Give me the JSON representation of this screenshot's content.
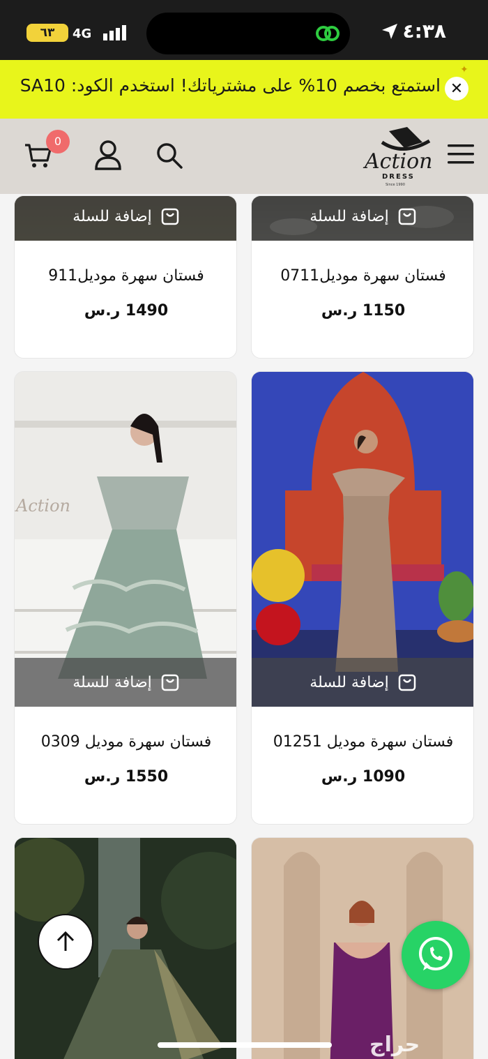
{
  "status_bar": {
    "time": "٤:٣٨",
    "battery": "٦٣",
    "signal_text": "4G"
  },
  "promo": {
    "text": "استمتع بخصم 10% على مشترياتك! استخدم الكود: SA10",
    "close_symbol": "✕"
  },
  "header": {
    "logo_title": "Action",
    "logo_subtitle": "DRESS",
    "logo_since": "Since 1990",
    "cart_count": "0"
  },
  "products": [
    {
      "name": "فستان سهرة موديل0711",
      "price": "1150 ر.س",
      "add_label": "إضافة للسلة"
    },
    {
      "name": "فستان سهرة موديل911",
      "price": "1490 ر.س",
      "add_label": "إضافة للسلة"
    },
    {
      "name": "فستان سهرة موديل 01251",
      "price": "1090 ر.س",
      "add_label": "إضافة للسلة"
    },
    {
      "name": "فستان سهرة موديل 0309",
      "price": "1550 ر.س",
      "add_label": "إضافة للسلة"
    },
    {
      "name": "",
      "price": "",
      "add_label": ""
    },
    {
      "name": "",
      "price": "",
      "add_label": ""
    }
  ],
  "watermark": "حراج",
  "colors": {
    "promo_bg": "#e8f51b",
    "header_bg": "#dcd8d3",
    "whatsapp": "#27d366",
    "badge": "#f06b6b"
  }
}
